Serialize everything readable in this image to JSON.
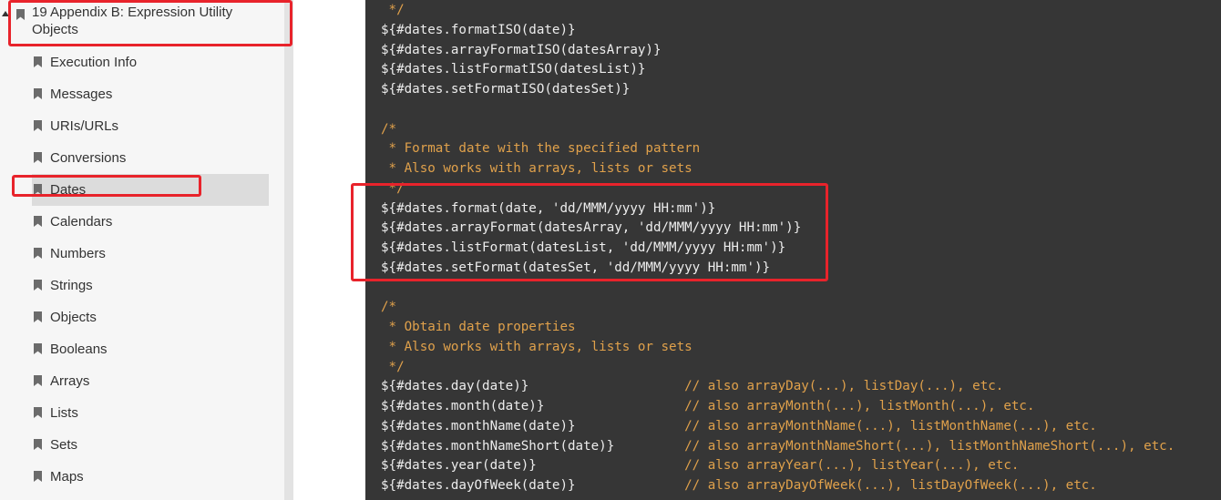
{
  "sidebar": {
    "parent_label": "19 Appendix B: Expression Utility Objects",
    "items": [
      {
        "label": "Execution Info"
      },
      {
        "label": "Messages"
      },
      {
        "label": "URIs/URLs"
      },
      {
        "label": "Conversions"
      },
      {
        "label": "Dates",
        "active": true
      },
      {
        "label": "Calendars"
      },
      {
        "label": "Numbers"
      },
      {
        "label": "Strings"
      },
      {
        "label": "Objects"
      },
      {
        "label": "Booleans"
      },
      {
        "label": "Arrays"
      },
      {
        "label": "Lists"
      },
      {
        "label": "Sets"
      },
      {
        "label": "Maps"
      }
    ]
  },
  "code": {
    "lines": [
      {
        "code": "",
        "comment": " */"
      },
      {
        "code": "${#dates.formatISO(date)}",
        "comment": ""
      },
      {
        "code": "${#dates.arrayFormatISO(datesArray)}",
        "comment": ""
      },
      {
        "code": "${#dates.listFormatISO(datesList)}",
        "comment": ""
      },
      {
        "code": "${#dates.setFormatISO(datesSet)}",
        "comment": ""
      },
      {
        "code": "",
        "comment": ""
      },
      {
        "code": "",
        "comment": "/*"
      },
      {
        "code": "",
        "comment": " * Format date with the specified pattern"
      },
      {
        "code": "",
        "comment": " * Also works with arrays, lists or sets"
      },
      {
        "code": "",
        "comment": " */"
      },
      {
        "code": "${#dates.format(date, 'dd/MMM/yyyy HH:mm')}",
        "comment": ""
      },
      {
        "code": "${#dates.arrayFormat(datesArray, 'dd/MMM/yyyy HH:mm')}",
        "comment": ""
      },
      {
        "code": "${#dates.listFormat(datesList, 'dd/MMM/yyyy HH:mm')}",
        "comment": ""
      },
      {
        "code": "${#dates.setFormat(datesSet, 'dd/MMM/yyyy HH:mm')}",
        "comment": ""
      },
      {
        "code": "",
        "comment": ""
      },
      {
        "code": "",
        "comment": "/*"
      },
      {
        "code": "",
        "comment": " * Obtain date properties"
      },
      {
        "code": "",
        "comment": " * Also works with arrays, lists or sets"
      },
      {
        "code": "",
        "comment": " */"
      },
      {
        "code": "${#dates.day(date)}                    ",
        "comment": "// also arrayDay(...), listDay(...), etc."
      },
      {
        "code": "${#dates.month(date)}                  ",
        "comment": "// also arrayMonth(...), listMonth(...), etc."
      },
      {
        "code": "${#dates.monthName(date)}              ",
        "comment": "// also arrayMonthName(...), listMonthName(...), etc."
      },
      {
        "code": "${#dates.monthNameShort(date)}         ",
        "comment": "// also arrayMonthNameShort(...), listMonthNameShort(...), etc."
      },
      {
        "code": "${#dates.year(date)}                   ",
        "comment": "// also arrayYear(...), listYear(...), etc."
      },
      {
        "code": "${#dates.dayOfWeek(date)}              ",
        "comment": "// also arrayDayOfWeek(...), listDayOfWeek(...), etc."
      }
    ]
  },
  "colors": {
    "highlight": "#e8232b",
    "code_bg": "#363636",
    "comment": "#e0a14b"
  }
}
